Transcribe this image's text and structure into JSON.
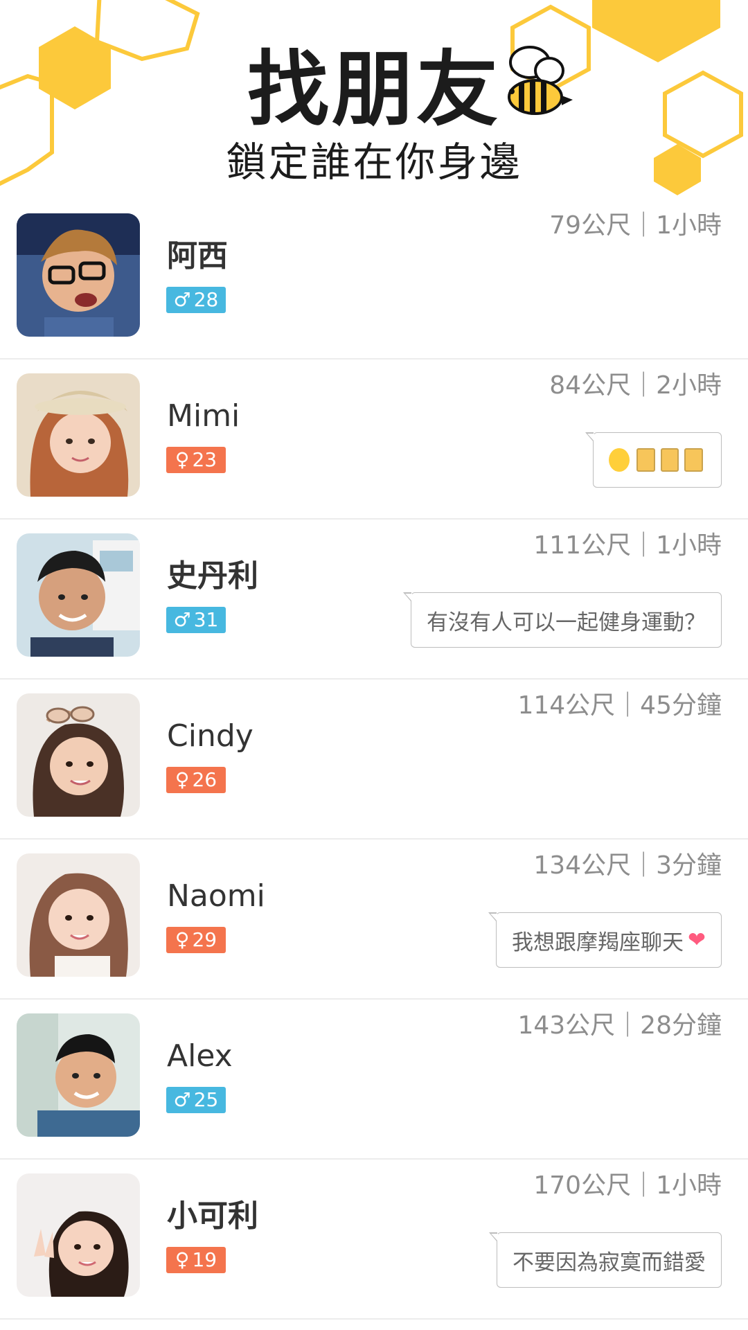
{
  "header": {
    "title": "找朋友",
    "subtitle": "鎖定誰在你身邊"
  },
  "colors": {
    "honey": "#fcc93b",
    "male": "#47b8e0",
    "female": "#f4744d"
  },
  "users": [
    {
      "name": "阿西",
      "gender": "male",
      "gender_symbol": "♂",
      "age": "28",
      "distance": "79公尺",
      "time": "1小時",
      "meta": "79公尺｜1小時",
      "message": "",
      "avatar_icon": "photo-avatar"
    },
    {
      "name": "Mimi",
      "gender": "female",
      "gender_symbol": "♀",
      "age": "23",
      "distance": "84公尺",
      "time": "2小時",
      "meta": "84公尺｜2小時",
      "message": "",
      "message_icons": [
        "heart-eyes-emoji",
        "beer-emoji",
        "beer-emoji",
        "beer-emoji"
      ],
      "avatar_icon": "photo-avatar"
    },
    {
      "name": "史丹利",
      "gender": "male",
      "gender_symbol": "♂",
      "age": "31",
      "distance": "111公尺",
      "time": "1小時",
      "meta": "111公尺｜1小時",
      "message": "有沒有人可以一起健身運動？",
      "avatar_icon": "photo-avatar"
    },
    {
      "name": "Cindy",
      "gender": "female",
      "gender_symbol": "♀",
      "age": "26",
      "distance": "114公尺",
      "time": "45分鐘",
      "meta": "114公尺｜45分鐘",
      "message": "",
      "avatar_icon": "photo-avatar"
    },
    {
      "name": "Naomi",
      "gender": "female",
      "gender_symbol": "♀",
      "age": "29",
      "distance": "134公尺",
      "time": "3分鐘",
      "meta": "134公尺｜3分鐘",
      "message": "我想跟摩羯座聊天",
      "message_end_icon": "heart-emoji",
      "avatar_icon": "photo-avatar"
    },
    {
      "name": "Alex",
      "gender": "male",
      "gender_symbol": "♂",
      "age": "25",
      "distance": "143公尺",
      "time": "28分鐘",
      "meta": "143公尺｜28分鐘",
      "message": "",
      "avatar_icon": "photo-avatar"
    },
    {
      "name": "小可利",
      "gender": "female",
      "gender_symbol": "♀",
      "age": "19",
      "distance": "170公尺",
      "time": "1小時",
      "meta": "170公尺｜1小時",
      "message": "不要因為寂寞而錯愛",
      "avatar_icon": "photo-avatar"
    }
  ]
}
